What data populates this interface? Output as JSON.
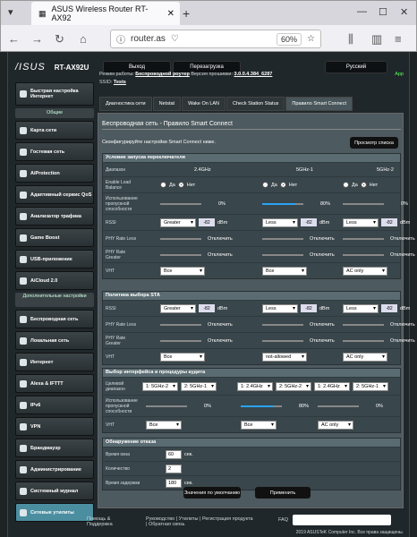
{
  "browser": {
    "tab_title": "ASUS Wireless Router RT-AX92",
    "url": "router.as",
    "zoom": "60%"
  },
  "router": {
    "brand": "/ISUS",
    "model": "RT-AX92U",
    "logout": "Выход",
    "reboot": "Перезагрузка",
    "language": "Русский"
  },
  "info": {
    "mode_label": "Режим работы:",
    "mode_value": "Беспроводной роутер",
    "fw_label": "Версия прошивки:",
    "fw_value": "3.0.0.4.384_6287",
    "ssid_label": "SSID:",
    "ssid_value": "Tests",
    "app": "App"
  },
  "sidebar": {
    "quick": "Быстрая настройка Интернет",
    "general_head": "Общие",
    "general": [
      "Карта сети",
      "Гостевая сеть",
      "AiProtection",
      "Адаптивный сервис QoS",
      "Анализатор трафика",
      "Game Boost",
      "USB-приложение",
      "AiCloud 2.0"
    ],
    "advanced_head": "Дополнительные настройки",
    "advanced": [
      "Беспроводная сеть",
      "Локальная сеть",
      "Интернет",
      "Alexa & IFTTT",
      "IPv6",
      "VPN",
      "Брандмауэр",
      "Администрирование",
      "Системный журнал",
      "Сетевые утилиты"
    ]
  },
  "tabs": [
    "Диагностика сети",
    "Netstat",
    "Wake On LAN",
    "Check Station Status",
    "Правило Smart Connect"
  ],
  "main": {
    "title": "Беспроводная сеть - Правило Smart Connect",
    "desc": "Сконфигурируйте настройки Smart Connect ниже.",
    "view_list": "Просмотр списка"
  },
  "trigger": {
    "head": "Условие запуска переключателя",
    "labels": [
      "Диапазон",
      "Enable Load Balance",
      "Использование пропускной способности",
      "RSSI",
      "PHY Rate Less",
      "PHY Rate Greater",
      "VHT"
    ],
    "bands": [
      "2.4GHz",
      "5GHz-1",
      "5GHz-2"
    ],
    "yes": "Да",
    "no": "Нет",
    "bw": [
      "0%",
      "80%",
      "0%"
    ],
    "rssi_cmp": [
      "Greater",
      "Less",
      "Less"
    ],
    "rssi_val": [
      "-82",
      "-82",
      "-82"
    ],
    "dbm": "dBm",
    "off": "Отключить",
    "vht": [
      "Все",
      "Все",
      "AC only"
    ]
  },
  "policy": {
    "head": "Политика выбора STA",
    "labels": [
      "RSSI",
      "PHY Rate Less",
      "PHY Rate Greater",
      "VHT"
    ],
    "rssi_cmp": [
      "Greater",
      "Less",
      "Less"
    ],
    "rssi_val": [
      "-82",
      "-82",
      "-82"
    ],
    "dbm": "dBm",
    "off": "Отключить",
    "vht": [
      "Все",
      "not-allowed",
      "AC only"
    ]
  },
  "iface": {
    "head": "Выбор интерфейса и процедуры аудита",
    "labels": [
      "Целевой диапазон",
      "Использование пропускной способности",
      "VHT"
    ],
    "targets": [
      [
        "1: 5GHz-2",
        "2: 5GHz-1"
      ],
      [
        "1: 2.4GHz",
        "2: 5GHz-2"
      ],
      [
        "1: 2.4GHz",
        "2: 5GHz-1"
      ]
    ],
    "bw": [
      "0%",
      "80%",
      "0%"
    ],
    "vht": [
      "Все",
      "Все",
      "AC only"
    ]
  },
  "bounce": {
    "head": "Обнаружение отказа",
    "labels": [
      "Время окна",
      "Количество",
      "Время задержки"
    ],
    "values": [
      "60",
      "2",
      "180"
    ],
    "unit": "сек."
  },
  "buttons": {
    "default": "Значения по умолчанию",
    "apply": "Применить"
  },
  "footer": {
    "help": "Помощь & Поддержка",
    "links": "Руководство | Утилиты | Регистрация продукта | Обратная связь",
    "faq": "FAQ",
    "copyright": "2019 ASUSTeK Computer Inc. Все права защищены."
  }
}
